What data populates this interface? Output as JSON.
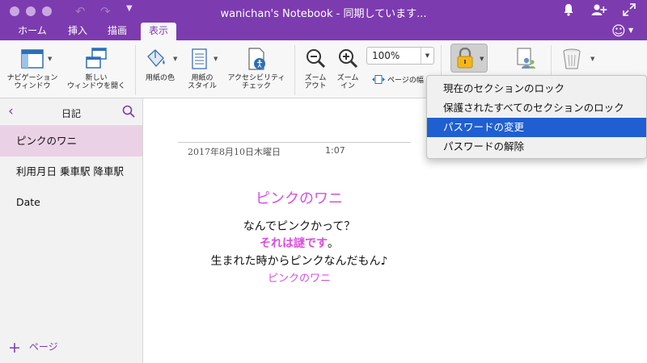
{
  "titlebar": {
    "title": "wanichan's Notebook - 同期しています...",
    "undo_icon": "undo-icon",
    "redo_icon": "redo-icon",
    "accent": "#7d3bb0"
  },
  "tabs": [
    {
      "label": "ホーム"
    },
    {
      "label": "挿入"
    },
    {
      "label": "描画"
    },
    {
      "label": "表示",
      "active": true
    }
  ],
  "ribbon": {
    "nav_window": "ナビゲーション\nウィンドウ",
    "new_window": "新しい\nウィンドウを開く",
    "paper_color": "用紙の色",
    "paper_style": "用紙の\nスタイル",
    "accessibility": "アクセシビリティ\nチェック",
    "zoom_out": "ズーム\nアウト",
    "zoom_in": "ズーム\nイン",
    "zoom_value": "100%",
    "page_width": "ページの幅"
  },
  "sidebar": {
    "section_title": "日記",
    "pages": [
      {
        "title": "ピンクのワニ",
        "selected": true
      },
      {
        "title": "利用月日  乗車駅    降車駅"
      },
      {
        "title": "Date"
      }
    ],
    "add_page": "ページ"
  },
  "note": {
    "date": "2017年8月10日木曜日",
    "time": "1:07",
    "title": "ピンクのワニ",
    "line1": "なんでピンクかって？",
    "line2_pink": "それは謎です",
    "line2_end": "。",
    "line3": "生まれた時からピンクなんだもん♪",
    "line4": "ピンクのワニ"
  },
  "lock_menu": {
    "items": [
      {
        "label": "現在のセクションのロック"
      },
      {
        "label": "保護されたすべてのセクションのロック"
      },
      {
        "label": "パスワードの変更",
        "highlighted": true
      },
      {
        "label": "パスワードの解除"
      }
    ],
    "highlight_color": "#1f5fd1"
  }
}
